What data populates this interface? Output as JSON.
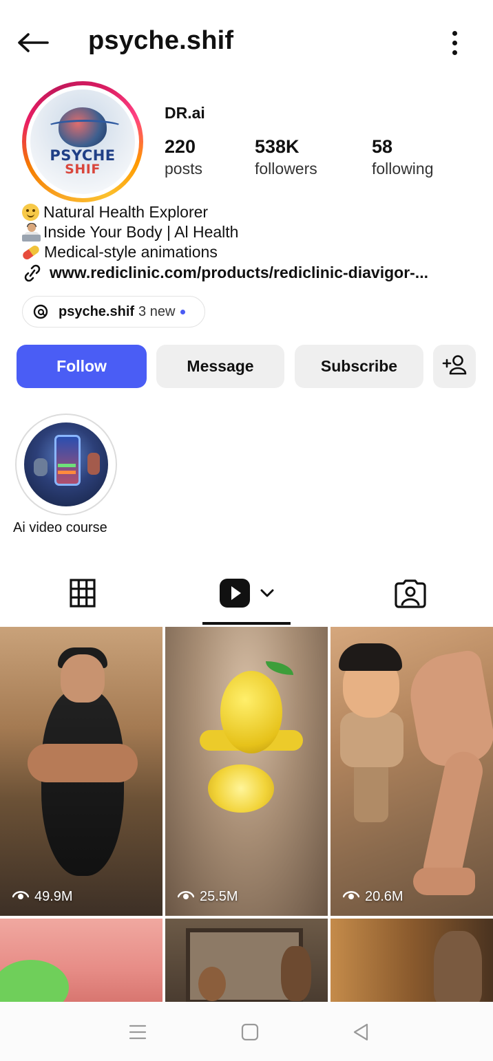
{
  "header": {
    "username": "psyche.shif"
  },
  "profile": {
    "display_name": "DR.ai",
    "avatar_text_line1": "PSYCHE",
    "avatar_text_line2": "SHIF",
    "stats": {
      "posts_value": "220",
      "posts_label": "posts",
      "followers_value": "538K",
      "followers_label": "followers",
      "following_value": "58",
      "following_label": "following"
    },
    "bio": {
      "line1": "Natural Health Explorer",
      "line2": "Inside Your Body | Al Health",
      "line3": "Medical-style animations",
      "link": "www.rediclinic.com/products/rediclinic-diavigor-..."
    },
    "threads": {
      "handle": "psyche.shif",
      "new_count": "3 new"
    }
  },
  "actions": {
    "follow": "Follow",
    "message": "Message",
    "subscribe": "Subscribe"
  },
  "highlights": [
    {
      "label": "Ai video course"
    }
  ],
  "tabs": {
    "active": "reels",
    "icons": [
      "grid-icon",
      "reels-icon",
      "tagged-icon"
    ]
  },
  "reels": [
    {
      "views": "49.9M"
    },
    {
      "views": "25.5M"
    },
    {
      "views": "20.6M"
    },
    {
      "views": ""
    },
    {
      "views": ""
    },
    {
      "views": ""
    }
  ],
  "colors": {
    "follow_button": "#4a5df5",
    "secondary_button": "#efefef",
    "threads_dot": "#4a5bf4"
  }
}
